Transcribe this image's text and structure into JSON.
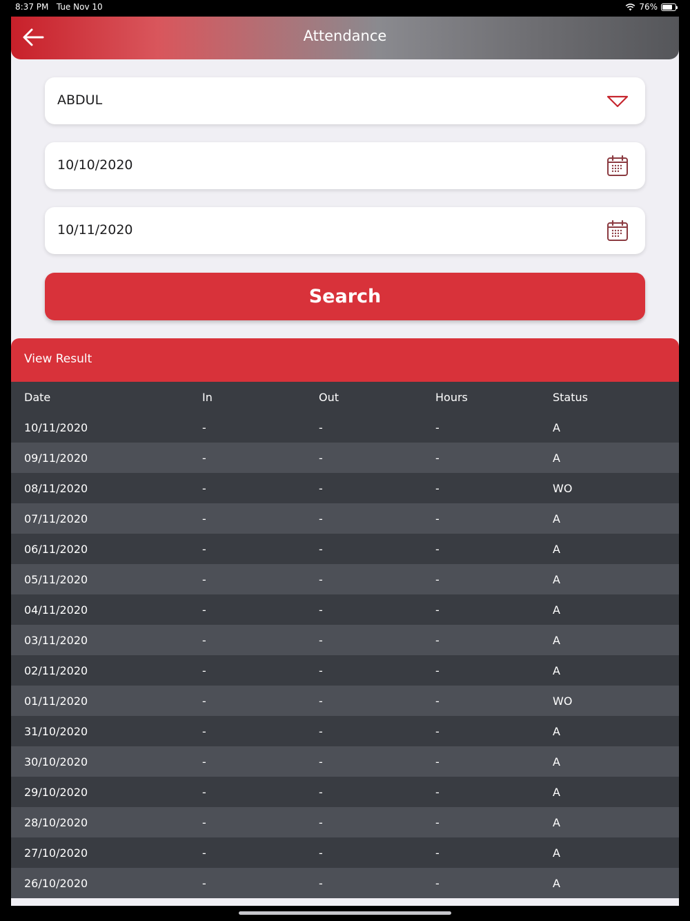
{
  "status_bar": {
    "time": "8:37 PM",
    "date": "Tue Nov 10",
    "battery": "76%"
  },
  "header": {
    "title": "Attendance"
  },
  "form": {
    "employee": "ABDUL",
    "from_date": "10/10/2020",
    "to_date": "10/11/2020",
    "search_label": "Search"
  },
  "results": {
    "title": "View Result",
    "columns": {
      "date": "Date",
      "in": "In",
      "out": "Out",
      "hours": "Hours",
      "status": "Status"
    },
    "rows": [
      {
        "date": "10/11/2020",
        "in": "-",
        "out": "-",
        "hours": "-",
        "status": "A"
      },
      {
        "date": "09/11/2020",
        "in": "-",
        "out": "-",
        "hours": "-",
        "status": "A"
      },
      {
        "date": "08/11/2020",
        "in": "-",
        "out": "-",
        "hours": "-",
        "status": "WO"
      },
      {
        "date": "07/11/2020",
        "in": "-",
        "out": "-",
        "hours": "-",
        "status": "A"
      },
      {
        "date": "06/11/2020",
        "in": "-",
        "out": "-",
        "hours": "-",
        "status": "A"
      },
      {
        "date": "05/11/2020",
        "in": "-",
        "out": "-",
        "hours": "-",
        "status": "A"
      },
      {
        "date": "04/11/2020",
        "in": "-",
        "out": "-",
        "hours": "-",
        "status": "A"
      },
      {
        "date": "03/11/2020",
        "in": "-",
        "out": "-",
        "hours": "-",
        "status": "A"
      },
      {
        "date": "02/11/2020",
        "in": "-",
        "out": "-",
        "hours": "-",
        "status": "A"
      },
      {
        "date": "01/11/2020",
        "in": "-",
        "out": "-",
        "hours": "-",
        "status": "WO"
      },
      {
        "date": "31/10/2020",
        "in": "-",
        "out": "-",
        "hours": "-",
        "status": "A"
      },
      {
        "date": "30/10/2020",
        "in": "-",
        "out": "-",
        "hours": "-",
        "status": "A"
      },
      {
        "date": "29/10/2020",
        "in": "-",
        "out": "-",
        "hours": "-",
        "status": "A"
      },
      {
        "date": "28/10/2020",
        "in": "-",
        "out": "-",
        "hours": "-",
        "status": "A"
      },
      {
        "date": "27/10/2020",
        "in": "-",
        "out": "-",
        "hours": "-",
        "status": "A"
      },
      {
        "date": "26/10/2020",
        "in": "-",
        "out": "-",
        "hours": "-",
        "status": "A"
      }
    ]
  },
  "icons": {
    "back": "arrow-left-icon",
    "dropdown": "chevron-down-icon",
    "calendar": "calendar-icon"
  },
  "colors": {
    "accent": "#d8323a",
    "row_dark": "#393c42",
    "row_light": "#4d5057"
  }
}
